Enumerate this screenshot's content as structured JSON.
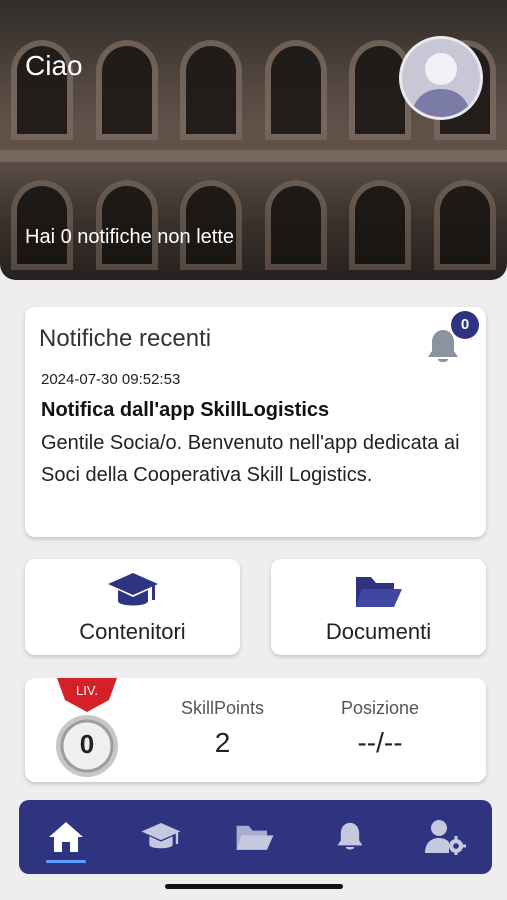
{
  "header": {
    "greeting": "Ciao",
    "unread_text": "Hai 0 notifiche non lette"
  },
  "notifications": {
    "title": "Notifiche recenti",
    "badge_count": "0",
    "date": "2024-07-30 09:52:53",
    "headline": "Notifica dall'app SkillLogistics",
    "body": "Gentile Socia/o. Benvenuto nell'app dedicata ai Soci della Cooperativa Skill Logistics."
  },
  "tiles": {
    "containers_label": "Contenitori",
    "documents_label": "Documenti"
  },
  "stats": {
    "level_label": "LIV.",
    "level_value": "0",
    "points_label": "SkillPoints",
    "points_value": "2",
    "position_label": "Posizione",
    "position_value": "--/--"
  },
  "nav": {
    "items": [
      {
        "icon": "home-icon",
        "active": true
      },
      {
        "icon": "graduation-cap-icon",
        "active": false
      },
      {
        "icon": "folder-icon",
        "active": false
      },
      {
        "icon": "bell-icon",
        "active": false
      },
      {
        "icon": "user-settings-icon",
        "active": false
      }
    ]
  },
  "colors": {
    "accent": "#2e3480",
    "nav_active_indicator": "#5aa0ff",
    "bell": "#8c93a0",
    "medal_ribbon": "#d62027"
  }
}
